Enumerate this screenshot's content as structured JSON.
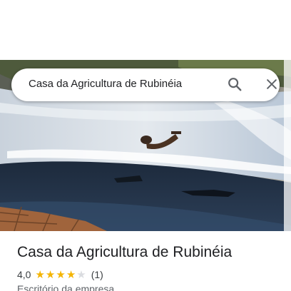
{
  "search": {
    "query": "Casa da Agricultura de Rubinéia"
  },
  "place": {
    "name": "Casa da Agricultura de Rubinéia",
    "rating_value": "4,0",
    "rating": 4,
    "rating_max": 5,
    "review_count": "(1)",
    "category": "Escritório da empresa"
  },
  "icons": {
    "search": "search-icon",
    "close": "close-icon",
    "star": "star-icon"
  },
  "colors": {
    "star_filled": "#f4b400",
    "star_empty": "#dadce0",
    "title_text": "#202124"
  }
}
